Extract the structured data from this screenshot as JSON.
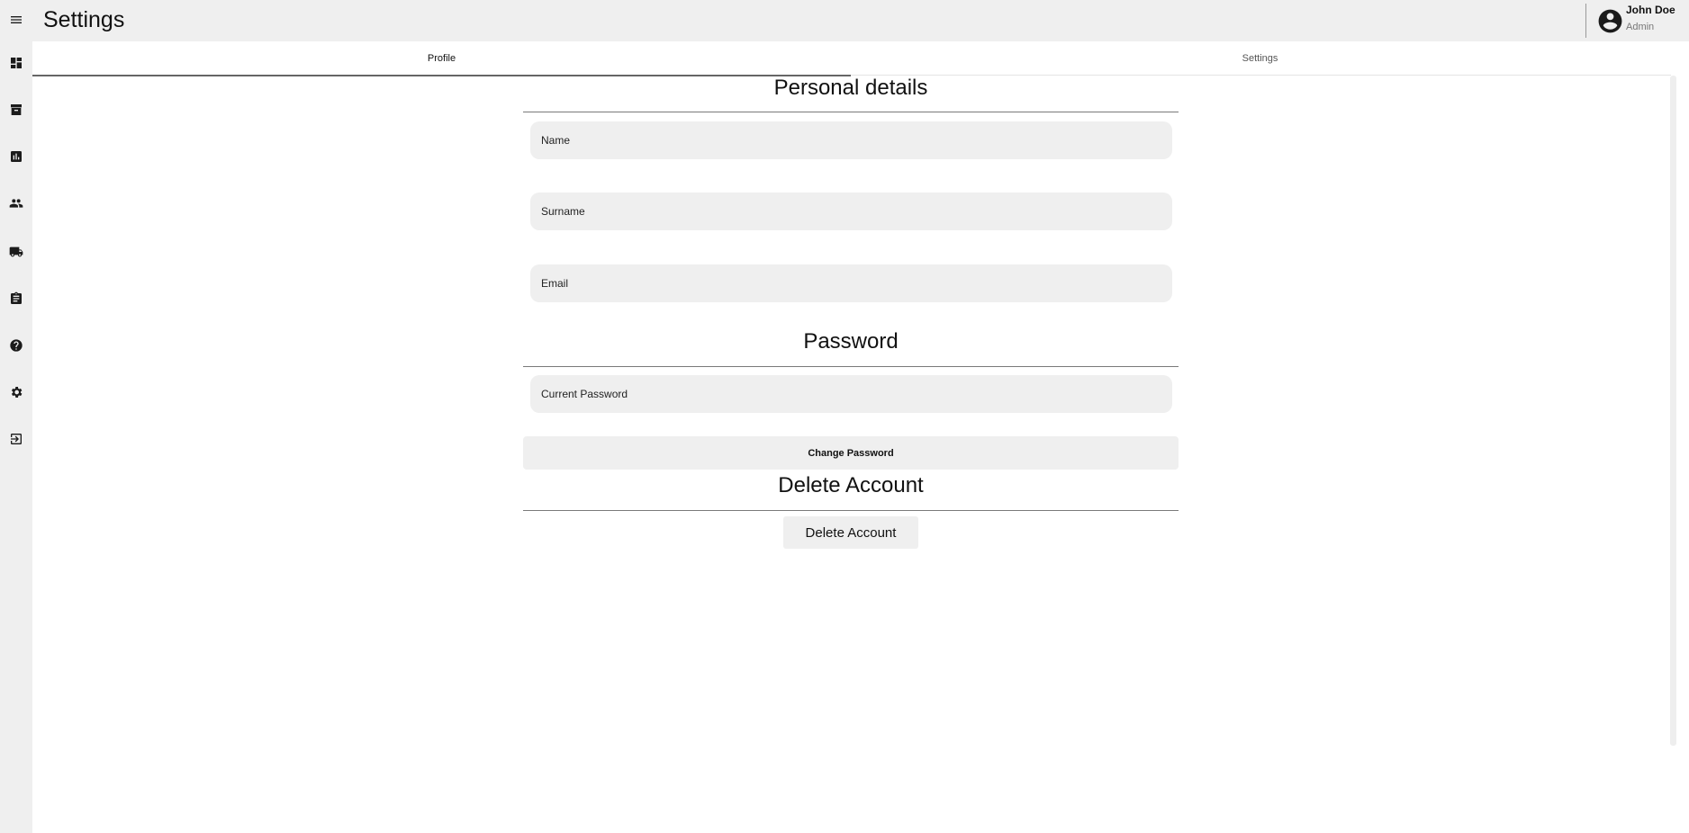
{
  "header": {
    "title": "Settings",
    "user": {
      "name": "John Doe",
      "role": "Admin"
    }
  },
  "sidebar": {
    "icons": [
      "menu-icon",
      "dashboard-icon",
      "archive-icon",
      "chart-icon",
      "people-icon",
      "truck-icon",
      "clipboard-icon",
      "help-icon",
      "gear-icon",
      "logout-icon"
    ]
  },
  "tabs": [
    {
      "label": "Profile",
      "active": true
    },
    {
      "label": "Settings",
      "active": false
    }
  ],
  "personal": {
    "title": "Personal details",
    "name_label": "Name",
    "surname_label": "Surname",
    "email_label": "Email"
  },
  "password": {
    "title": "Password",
    "current_label": "Current Password",
    "change_button": "Change Password"
  },
  "delete": {
    "title": "Delete Account",
    "button": "Delete Account"
  }
}
